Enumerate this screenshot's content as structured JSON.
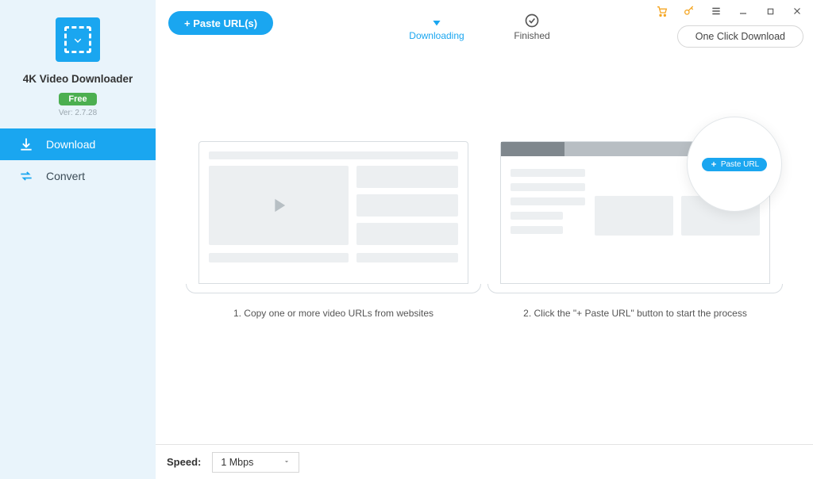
{
  "sidebar": {
    "title": "4K Video Downloader",
    "badge": "Free",
    "version": "Ver: 2.7.28",
    "items": [
      {
        "icon": "download-icon",
        "label": "Download"
      },
      {
        "icon": "convert-icon",
        "label": "Convert"
      }
    ]
  },
  "topbar": {
    "paste_label": "+ Paste URL(s)",
    "tabs": [
      {
        "label": "Downloading",
        "active": true
      },
      {
        "label": "Finished",
        "active": false
      }
    ],
    "one_click_label": "One Click Download"
  },
  "steps": {
    "step1_caption": "1. Copy one or more video URLs from websites",
    "step2_caption": "2. Click the \"+ Paste URL\" button to start the process",
    "bubble_label": "Paste URL"
  },
  "footer": {
    "speed_label": "Speed:",
    "speed_value": "1 Mbps",
    "speed_options": [
      "1 Mbps"
    ]
  },
  "colors": {
    "accent": "#1aa6f0",
    "sidebar_bg": "#e9f4fb",
    "badge_green": "#4caf50",
    "cart_orange": "#f5a623"
  }
}
